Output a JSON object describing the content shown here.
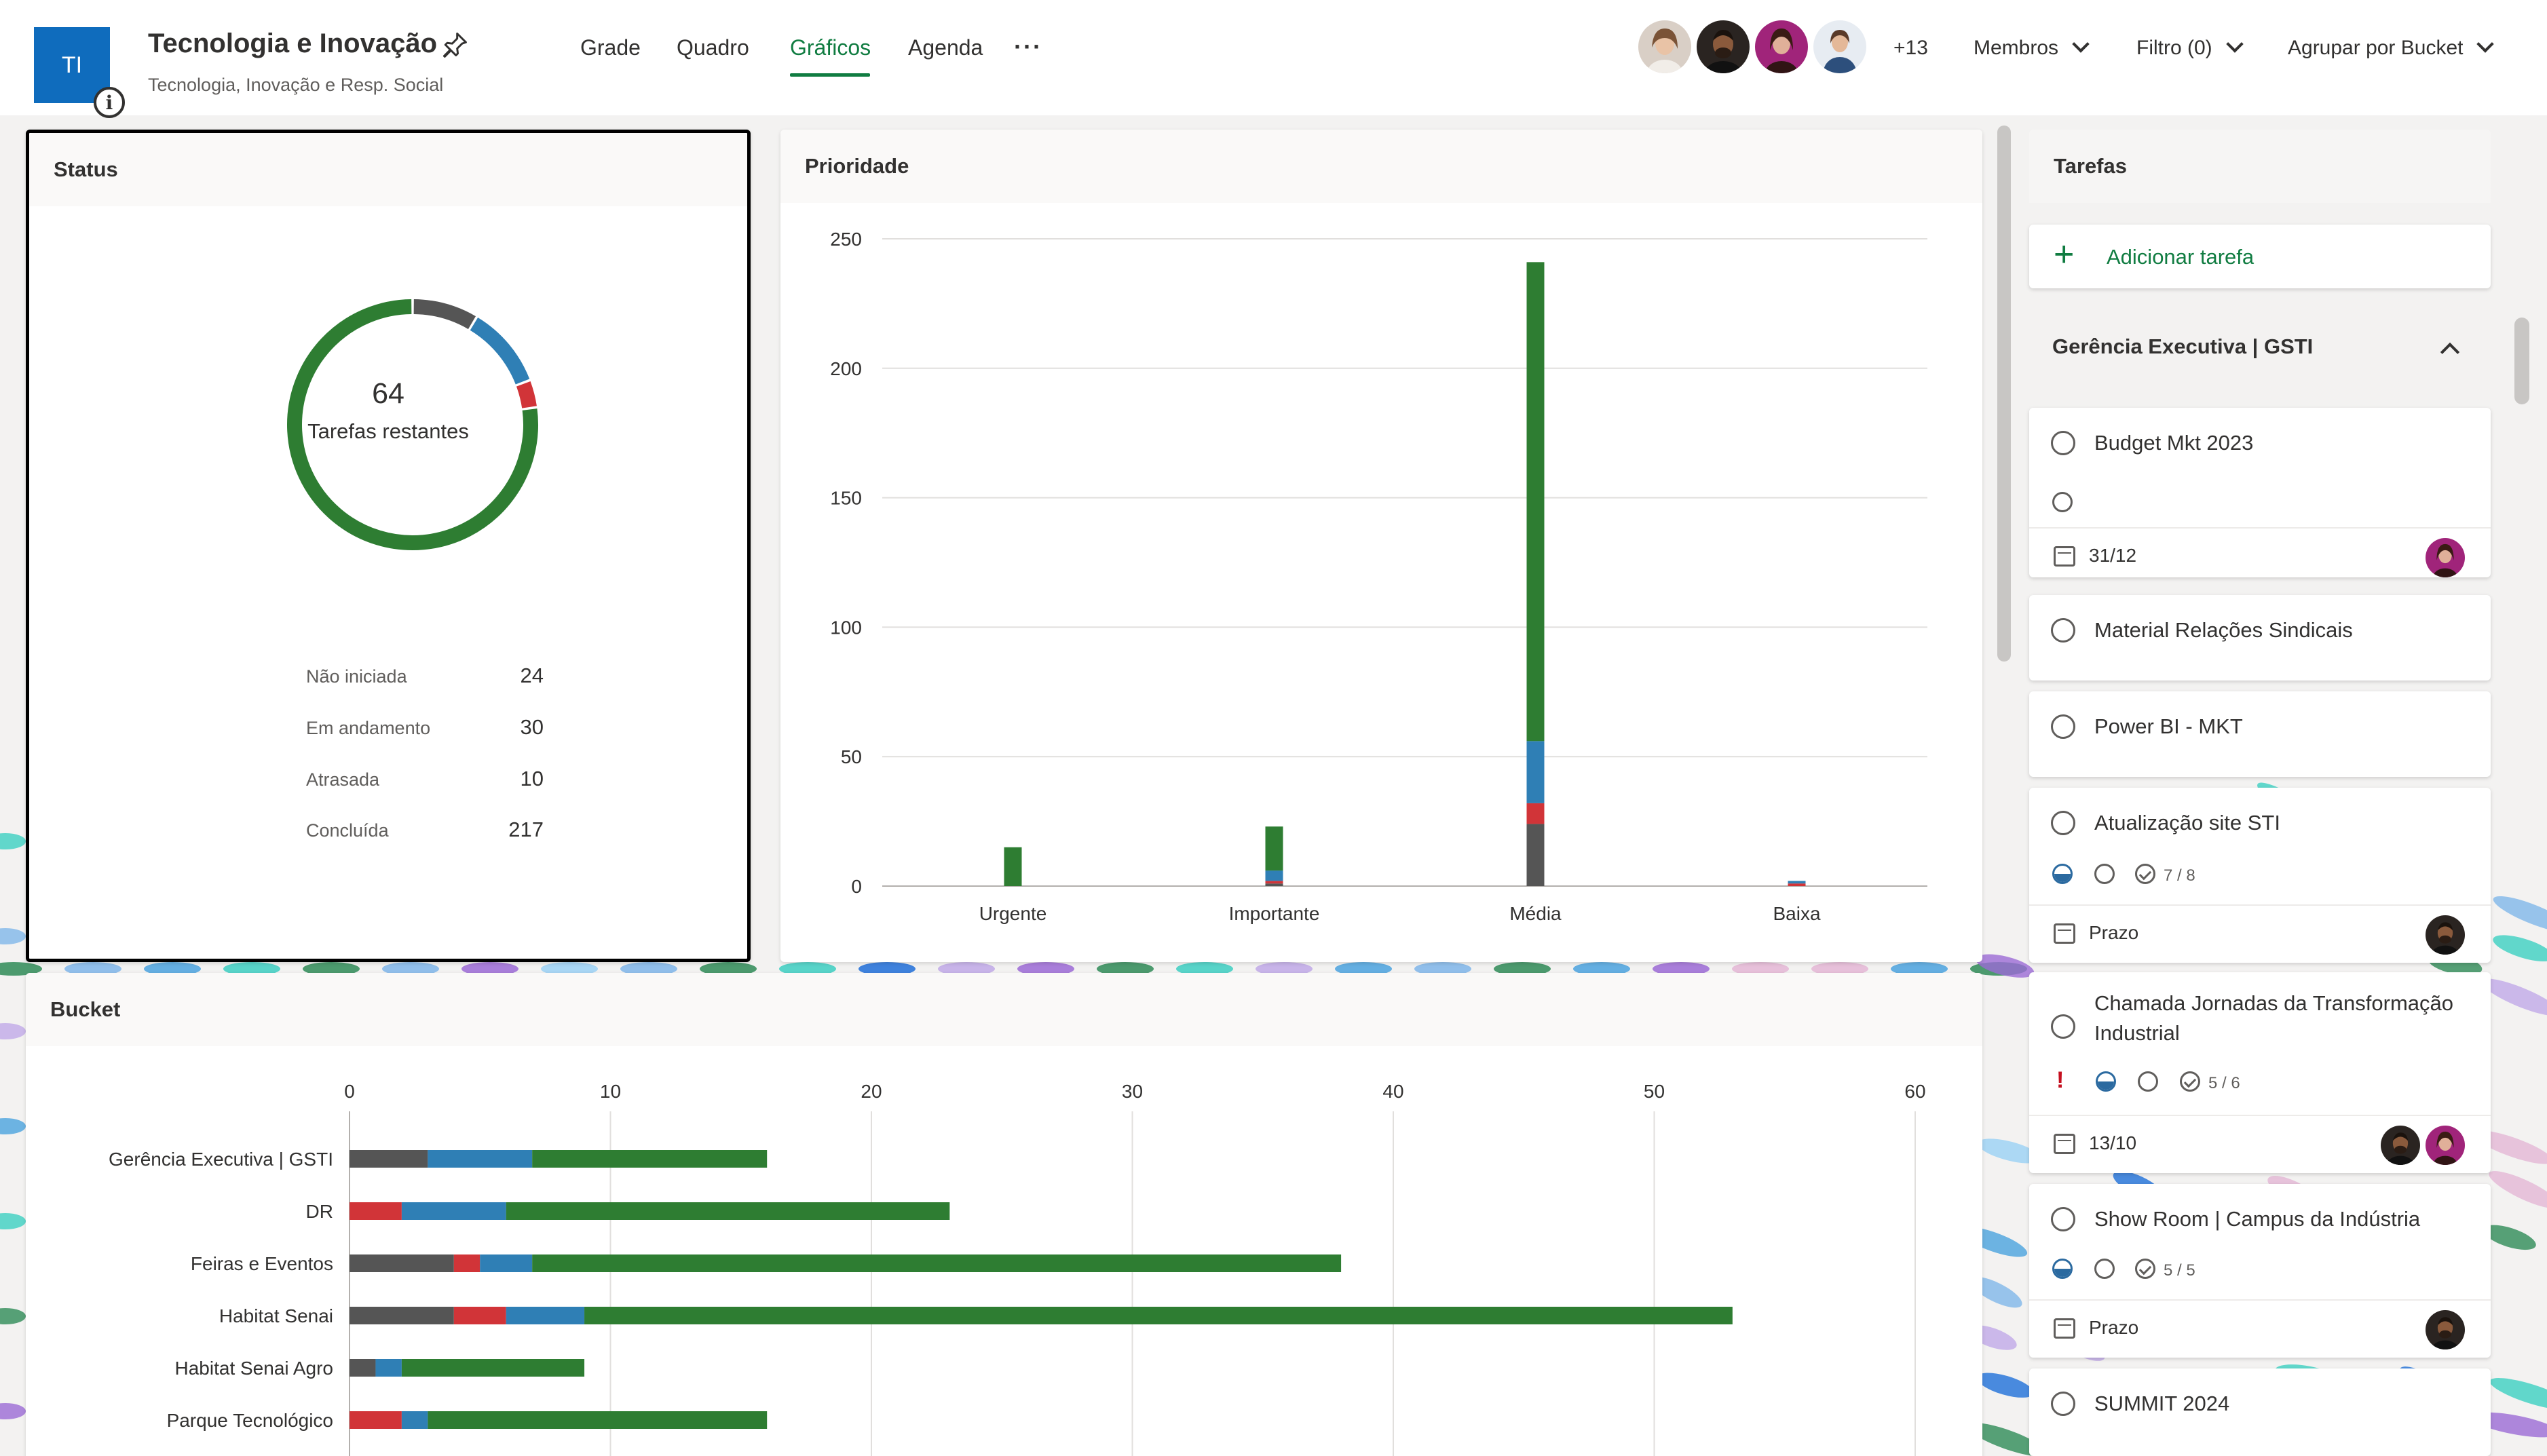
{
  "header": {
    "plan_initials": "TI",
    "plan_title": "Tecnologia e Inovação",
    "plan_subtitle": "Tecnologia, Inovação e Resp. Social",
    "tabs": [
      {
        "label": "Grade",
        "active": false
      },
      {
        "label": "Quadro",
        "active": false
      },
      {
        "label": "Gráficos",
        "active": true
      },
      {
        "label": "Agenda",
        "active": false
      }
    ],
    "more_label": "···",
    "extra_members": "+13",
    "members_label": "Membros",
    "filter_label": "Filtro (0)",
    "group_label": "Agrupar por Bucket"
  },
  "colors": {
    "not_started": "#555555",
    "in_progress": "#2f7fb5",
    "late": "#d13438",
    "completed": "#2e7d32",
    "accent": "#107c41",
    "brand": "#0f6cbd"
  },
  "status": {
    "title": "Status",
    "remaining_count": "64",
    "remaining_label": "Tarefas restantes",
    "rows": [
      {
        "label": "Não iniciada",
        "value": "24"
      },
      {
        "label": "Em andamento",
        "value": "30"
      },
      {
        "label": "Atrasada",
        "value": "10"
      },
      {
        "label": "Concluída",
        "value": "217"
      }
    ]
  },
  "priority": {
    "title": "Prioridade"
  },
  "bucket": {
    "title": "Bucket"
  },
  "chart_data": [
    {
      "type": "pie",
      "title": "Status",
      "categories": [
        "Não iniciada",
        "Em andamento",
        "Atrasada",
        "Concluída"
      ],
      "values": [
        24,
        30,
        10,
        217
      ]
    },
    {
      "type": "bar",
      "title": "Prioridade",
      "categories": [
        "Urgente",
        "Importante",
        "Média",
        "Baixa"
      ],
      "ylim": [
        0,
        250
      ],
      "yticks": [
        0,
        50,
        100,
        150,
        200,
        250
      ],
      "series": [
        {
          "name": "Não iniciada",
          "values": [
            0,
            1,
            24,
            0
          ]
        },
        {
          "name": "Atrasada",
          "values": [
            0,
            1,
            8,
            1
          ]
        },
        {
          "name": "Em andamento",
          "values": [
            0,
            4,
            24,
            1
          ]
        },
        {
          "name": "Concluída",
          "values": [
            15,
            17,
            185,
            0
          ]
        }
      ]
    },
    {
      "type": "bar",
      "orientation": "horizontal",
      "title": "Bucket",
      "categories": [
        "Gerência Executiva | GSTI",
        "DR",
        "Feiras e Eventos",
        "Habitat Senai",
        "Habitat Senai Agro",
        "Parque Tecnológico"
      ],
      "xlim": [
        0,
        60
      ],
      "xticks": [
        0,
        10,
        20,
        30,
        40,
        50,
        60
      ],
      "series": [
        {
          "name": "Não iniciada",
          "values": [
            3,
            0,
            4,
            4,
            1,
            0
          ]
        },
        {
          "name": "Atrasada",
          "values": [
            0,
            2,
            1,
            2,
            0,
            2
          ]
        },
        {
          "name": "Em andamento",
          "values": [
            4,
            4,
            2,
            3,
            1,
            1
          ]
        },
        {
          "name": "Concluída",
          "values": [
            9,
            17,
            31,
            44,
            7,
            13
          ]
        }
      ]
    }
  ],
  "tasks": {
    "title": "Tarefas",
    "add_label": "Adicionar tarefa",
    "group_name": "Gerência Executiva | GSTI",
    "items": [
      {
        "name": "Budget Mkt 2023",
        "due": "31/12",
        "checklist": ""
      },
      {
        "name": "Material Relações Sindicais",
        "due": "",
        "checklist": ""
      },
      {
        "name": "Power BI - MKT",
        "due": "",
        "checklist": ""
      },
      {
        "name": "Atualização site STI",
        "due": "Prazo",
        "checklist": "7 / 8"
      },
      {
        "name": "Chamada Jornadas da Transformação Industrial",
        "due": "13/10",
        "checklist": "5 / 6"
      },
      {
        "name": "Show Room | Campus da Indústria",
        "due": "Prazo",
        "checklist": "5 / 5"
      },
      {
        "name": "SUMMIT 2024",
        "due": "",
        "checklist": ""
      }
    ]
  }
}
